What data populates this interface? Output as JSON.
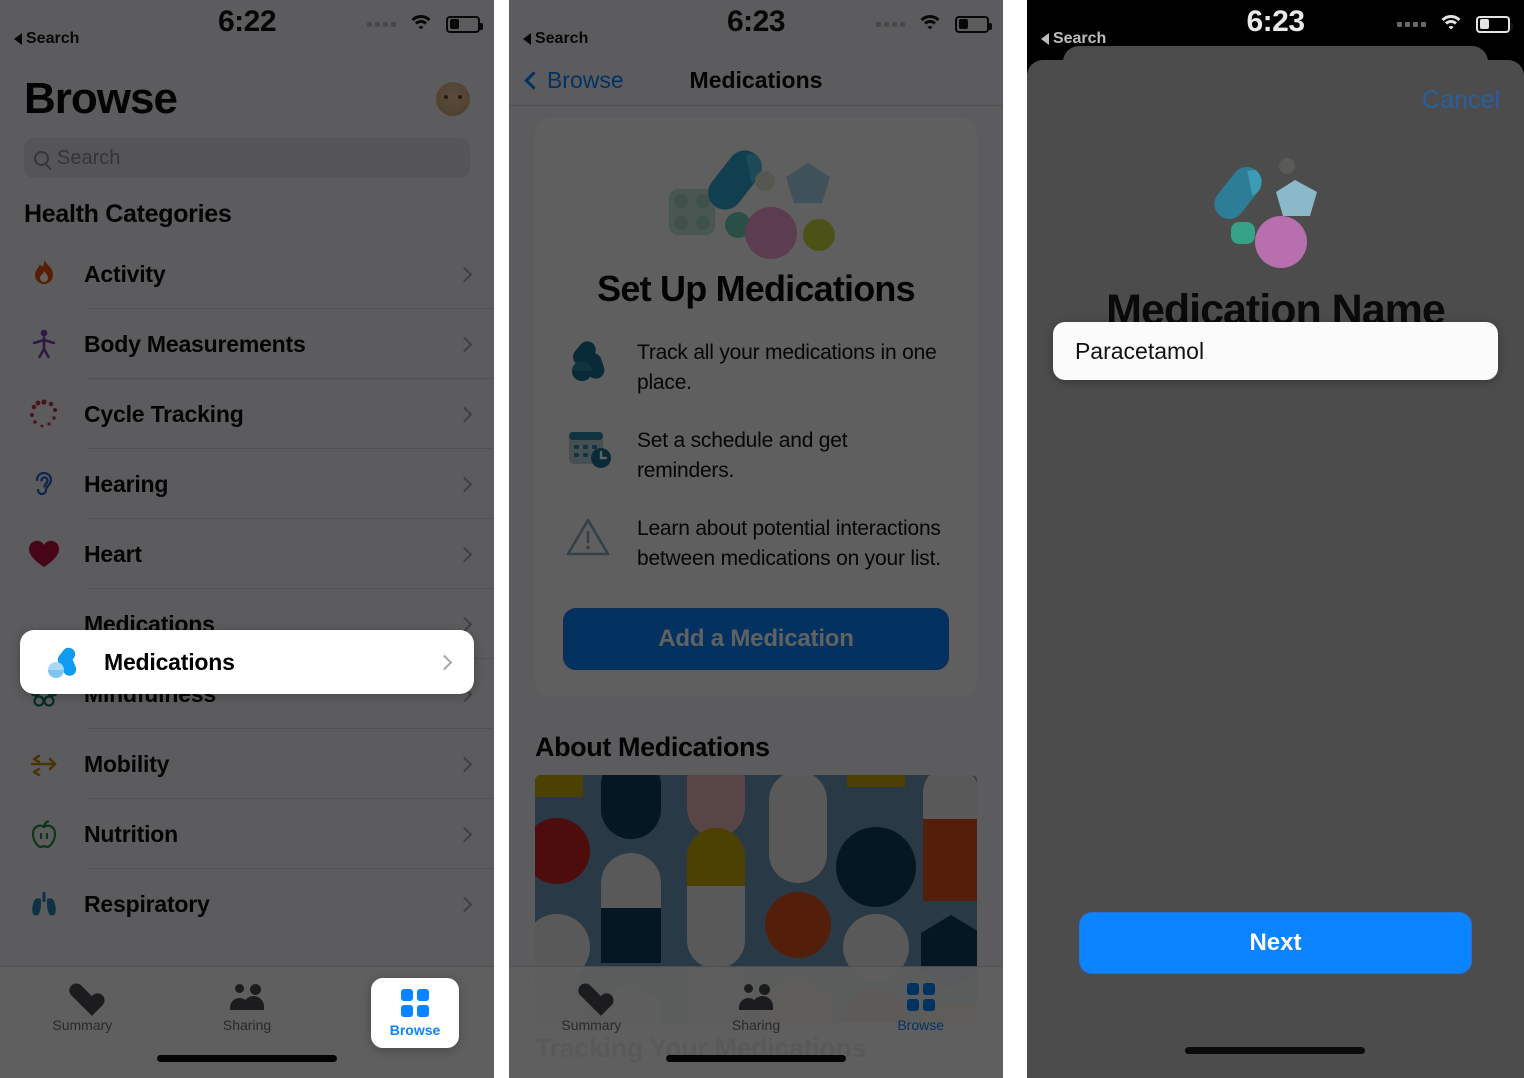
{
  "panel1": {
    "status": {
      "time": "6:22",
      "back_label": "Search",
      "wifi_icon": "wifi-icon",
      "battery_icon": "battery-icon"
    },
    "title": "Browse",
    "avatar_icon": "avatar",
    "search": {
      "placeholder": "Search",
      "icon": "search-icon"
    },
    "section_title": "Health Categories",
    "categories": [
      {
        "label": "Activity",
        "icon": "activity-flame-icon"
      },
      {
        "label": "Body Measurements",
        "icon": "body-measurements-icon"
      },
      {
        "label": "Cycle Tracking",
        "icon": "cycle-tracking-icon"
      },
      {
        "label": "Hearing",
        "icon": "hearing-ear-icon"
      },
      {
        "label": "Heart",
        "icon": "heart-icon"
      },
      {
        "label": "Medications",
        "icon": "medications-pills-icon"
      },
      {
        "label": "Mindfulness",
        "icon": "mindfulness-icon"
      },
      {
        "label": "Mobility",
        "icon": "mobility-arrows-icon"
      },
      {
        "label": "Nutrition",
        "icon": "nutrition-apple-icon"
      },
      {
        "label": "Respiratory",
        "icon": "respiratory-lungs-icon"
      }
    ],
    "highlighted_category": "Medications",
    "tabs": [
      {
        "label": "Summary",
        "icon": "heart-icon",
        "active": false
      },
      {
        "label": "Sharing",
        "icon": "people-icon",
        "active": false
      },
      {
        "label": "Browse",
        "icon": "grid-icon",
        "active": true
      }
    ]
  },
  "panel2": {
    "status": {
      "time": "6:23",
      "back_label": "Search",
      "wifi_icon": "wifi-icon",
      "battery_icon": "battery-icon"
    },
    "nav": {
      "back_label": "Browse",
      "title": "Medications",
      "back_icon": "chevron-left-icon"
    },
    "hero": {
      "image_icon": "pills-illustration",
      "title": "Set Up Medications"
    },
    "features": [
      {
        "icon": "pills-icon",
        "text": "Track all your medications in one place."
      },
      {
        "icon": "calendar-clock-icon",
        "text": "Set a schedule and get reminders."
      },
      {
        "icon": "warning-triangle-icon",
        "text": "Learn about potential interactions between medications on your list."
      }
    ],
    "cta_label": "Add a Medication",
    "about_title": "About Medications",
    "about_image_icon": "pills-pattern-image",
    "about_subtitle": "Tracking Your Medications",
    "tabs": [
      {
        "label": "Summary",
        "icon": "heart-icon",
        "active": false
      },
      {
        "label": "Sharing",
        "icon": "people-icon",
        "active": false
      },
      {
        "label": "Browse",
        "icon": "grid-icon",
        "active": true
      }
    ]
  },
  "panel3": {
    "status": {
      "time": "6:23",
      "back_label": "Search",
      "wifi_icon": "wifi-icon",
      "battery_icon": "battery-icon"
    },
    "cancel_label": "Cancel",
    "hero_icon": "pills-illustration",
    "title": "Medication Name",
    "input": {
      "value": "Paracetamol",
      "placeholder": "Medication Name"
    },
    "next_label": "Next"
  },
  "colors": {
    "accent_blue": "#0a84ff",
    "link_blue": "#2a5f9e",
    "dim_overlay": "rgba(0,0,0,0.62)",
    "sheet_bg": "#4c4c4c",
    "spotlight_bg": "#ffffff"
  }
}
